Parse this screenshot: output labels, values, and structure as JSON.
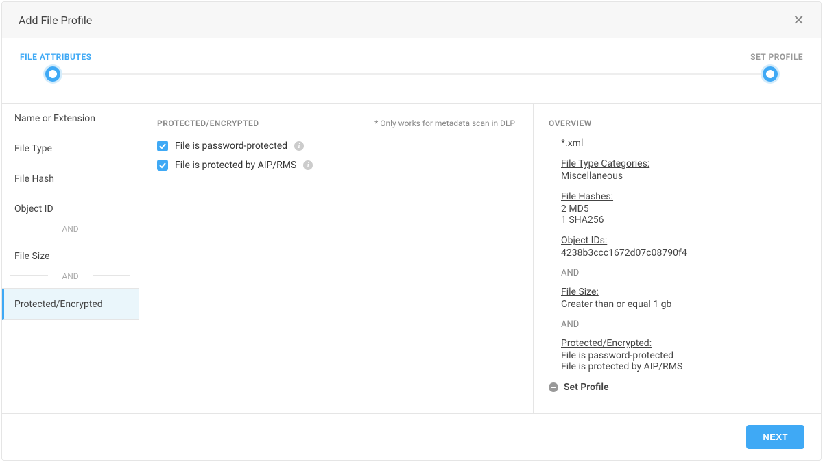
{
  "header": {
    "title": "Add File Profile"
  },
  "stepper": {
    "left_label": "FILE ATTRIBUTES",
    "right_label": "SET PROFILE"
  },
  "sidebar": {
    "items": [
      {
        "label": "Name or Extension"
      },
      {
        "label": "File Type"
      },
      {
        "label": "File Hash"
      },
      {
        "label": "Object ID"
      }
    ],
    "sep1": "AND",
    "item_filesize": "File Size",
    "sep2": "AND",
    "item_protected": "Protected/Encrypted"
  },
  "main": {
    "section_title": "PROTECTED/ENCRYPTED",
    "hint": "* Only works for metadata scan in DLP",
    "opt1": "File is password-protected",
    "opt2": "File is protected by AIP/RMS"
  },
  "overview": {
    "title": "OVERVIEW",
    "ext": "*.xml",
    "cat_head": "File Type Categories:",
    "cat_val": "Miscellaneous",
    "hash_head": "File Hashes:",
    "hash_v1": "2 MD5",
    "hash_v2": "1 SHA256",
    "obj_head": "Object IDs:",
    "obj_v1": "4238b3ccc1672d07c08790f4",
    "and1": "AND",
    "size_head": "File Size:",
    "size_v1": "Greater than or equal 1 gb",
    "and2": "AND",
    "prot_head": "Protected/Encrypted:",
    "prot_v1": "File is password-protected",
    "prot_v2": "File is protected by AIP/RMS",
    "set_profile": "Set Profile"
  },
  "footer": {
    "next": "NEXT"
  }
}
